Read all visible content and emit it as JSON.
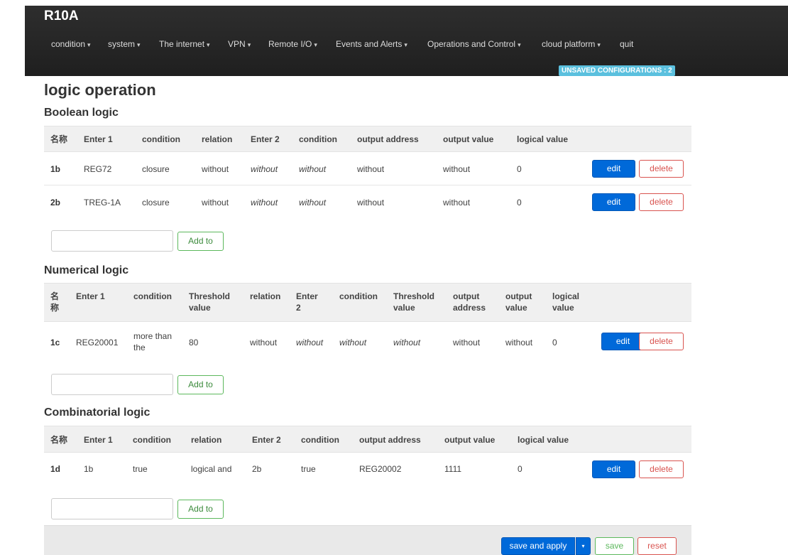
{
  "app": {
    "brand": "R10A"
  },
  "menu": [
    {
      "label": "condition",
      "dropdown": true
    },
    {
      "label": "system",
      "dropdown": true
    },
    {
      "label": "The internet",
      "dropdown": true
    },
    {
      "label": "VPN",
      "dropdown": true
    },
    {
      "label": "Remote I/O",
      "dropdown": true
    },
    {
      "label": "Events and Alerts",
      "dropdown": true
    },
    {
      "label": "Operations and Control",
      "dropdown": true
    },
    {
      "label": "cloud platform",
      "dropdown": true
    },
    {
      "label": "quit",
      "dropdown": false
    }
  ],
  "caret": "▾",
  "unsaved_badge": "UNSAVED CONFIGURATIONS : 2",
  "page_title": "logic operation",
  "boolean": {
    "title": "Boolean logic",
    "headers": [
      "名称",
      "Enter 1",
      "condition",
      "relation",
      "Enter 2",
      "condition",
      "output address",
      "output value",
      "logical value"
    ],
    "rows": [
      [
        "1b",
        "REG72",
        "closure",
        "without",
        "without",
        "without",
        "without",
        "without",
        "0"
      ],
      [
        "2b",
        "TREG-1A",
        "closure",
        "without",
        "without",
        "without",
        "without",
        "without",
        "0"
      ]
    ]
  },
  "numerical": {
    "title": "Numerical logic",
    "headers": [
      "名称",
      "Enter 1",
      "condition",
      "Threshold value",
      "relation",
      "Enter 2",
      "condition",
      "Threshold value",
      "output address",
      "output value",
      "logical value"
    ],
    "rows": [
      [
        "1c",
        "REG20001",
        "more than the",
        "80",
        "without",
        "without",
        "without",
        "without",
        "without",
        "without",
        "0"
      ]
    ]
  },
  "combinatorial": {
    "title": "Combinatorial logic",
    "headers": [
      "名称",
      "Enter 1",
      "condition",
      "relation",
      "Enter 2",
      "condition",
      "output address",
      "output value",
      "logical value"
    ],
    "rows": [
      [
        "1d",
        "1b",
        "true",
        "logical and",
        "2b",
        "true",
        "REG20002",
        "1111",
        "0"
      ]
    ]
  },
  "buttons": {
    "edit": "edit",
    "delete": "delete",
    "add": "Add to",
    "save_apply": "save and apply",
    "save": "save",
    "reset": "reset"
  },
  "add_input_values": [
    "",
    "",
    ""
  ]
}
